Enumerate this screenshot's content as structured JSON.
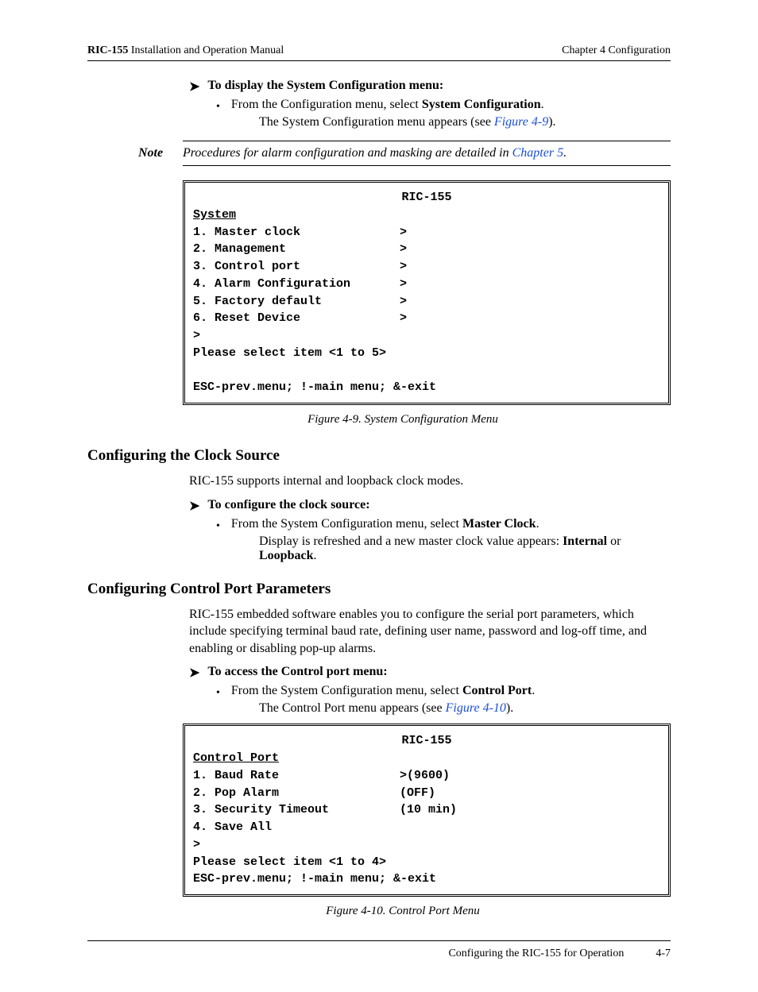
{
  "header": {
    "product": "RIC-155",
    "manual": " Installation and Operation Manual",
    "chapter": "Chapter 4  Configuration"
  },
  "proc1": {
    "title": "To display the System Configuration menu:",
    "bullet": "From the Configuration menu, select ",
    "bullet_bold": "System Configuration",
    "bullet_after": ".",
    "sub_pre": "The System Configuration menu appears (see ",
    "sub_link": "Figure 4-9",
    "sub_post": ")."
  },
  "note": {
    "label": "Note",
    "text_pre": "Procedures for alarm configuration and masking are detailed in ",
    "text_link": "Chapter 5",
    "text_post": "."
  },
  "term1": {
    "title": "RIC-155",
    "heading": "System",
    "rows": [
      {
        "l": "1. Master clock",
        "r": ">"
      },
      {
        "l": "2. Management",
        "r": ">"
      },
      {
        "l": "3. Control port",
        "r": ">"
      },
      {
        "l": "4. Alarm Configuration",
        "r": ">"
      },
      {
        "l": "5. Factory default",
        "r": ">"
      },
      {
        "l": "6. Reset Device",
        "r": ">"
      }
    ],
    "prompt": ">",
    "select": "Please select item <1 to 5>",
    "blank": " ",
    "footer": "ESC-prev.menu; !-main menu; &-exit"
  },
  "fig1": "Figure 4-9.  System Configuration Menu",
  "section1": {
    "h": "Configuring the Clock Source",
    "p": "RIC-155 supports internal and loopback clock modes."
  },
  "proc2": {
    "title": "To configure the clock source:",
    "bullet": "From the System Configuration menu, select ",
    "bullet_bold": "Master Clock",
    "bullet_after": ".",
    "sub1_pre": "Display is refreshed and a new master clock value appears: ",
    "sub1_b1": "Internal",
    "sub1_mid": " or ",
    "sub1_b2": "Loopback",
    "sub1_post": "."
  },
  "section2": {
    "h": "Configuring Control Port Parameters",
    "p": "RIC-155 embedded software enables you to configure the serial port parameters, which include specifying terminal baud rate, defining user name, password and log-off time, and enabling or disabling pop-up alarms."
  },
  "proc3": {
    "title": "To access the Control port menu:",
    "bullet": "From the System Configuration menu, select ",
    "bullet_bold": "Control Port",
    "bullet_after": ".",
    "sub_pre": "The Control Port menu appears (see ",
    "sub_link": "Figure 4-10",
    "sub_post": ")."
  },
  "term2": {
    "title": "RIC-155",
    "heading": "Control Port",
    "rows": [
      {
        "l": "1. Baud Rate",
        "r": ">(9600)"
      },
      {
        "l": "2. Pop Alarm",
        "r": "(OFF)"
      },
      {
        "l": "3. Security Timeout",
        "r": "(10 min)"
      },
      {
        "l": "4. Save All",
        "r": ""
      }
    ],
    "prompt": ">",
    "select": "Please select item <1 to 4>",
    "footer": "ESC-prev.menu; !-main menu; &-exit"
  },
  "fig2": "Figure 4-10.  Control Port Menu",
  "footer": {
    "section": "Configuring the RIC-155 for Operation",
    "page": "4-7"
  }
}
